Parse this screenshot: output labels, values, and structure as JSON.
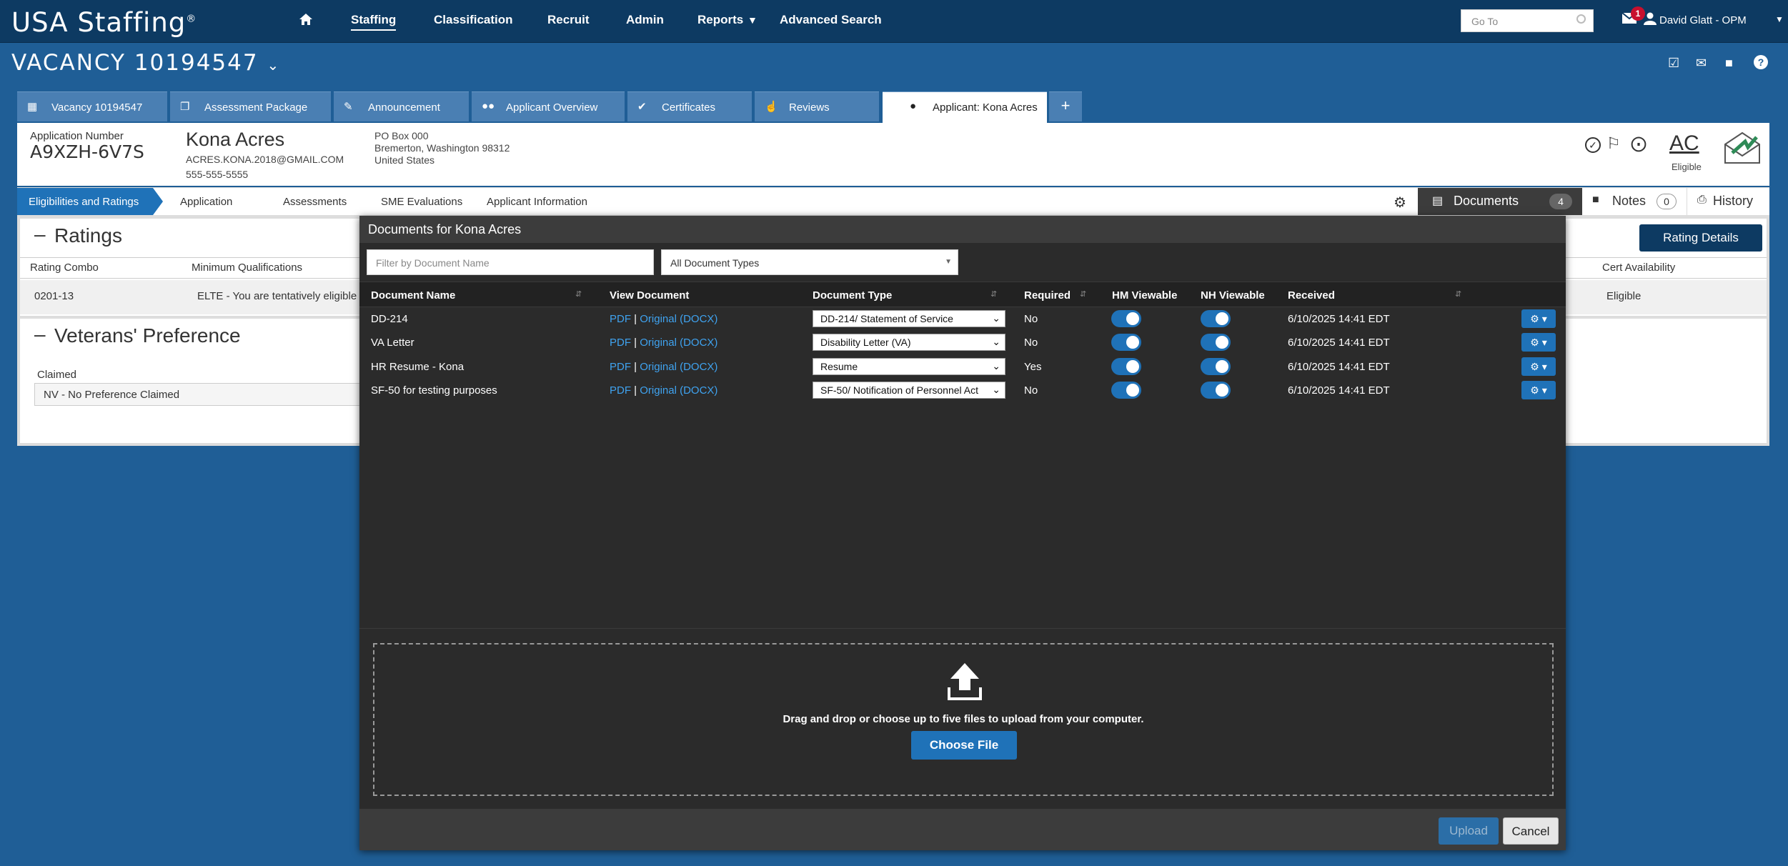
{
  "topnav": {
    "logo": "USA Staffing",
    "logo_mark": "®",
    "items": [
      "Staffing",
      "Classification",
      "Recruit",
      "Admin",
      "Reports",
      "Advanced Search"
    ],
    "goto_placeholder": "Go To",
    "notification_count": "1",
    "user": "David Glatt - OPM"
  },
  "vacancy": {
    "title": "VACANCY 10194547"
  },
  "tabs": [
    {
      "label": "Vacancy 10194547",
      "icon": "calendar-icon"
    },
    {
      "label": "Assessment Package",
      "icon": "copy-icon"
    },
    {
      "label": "Announcement",
      "icon": "megaphone-icon"
    },
    {
      "label": "Applicant Overview",
      "icon": "people-icon"
    },
    {
      "label": "Certificates",
      "icon": "check-circle-icon"
    },
    {
      "label": "Reviews",
      "icon": "thumbs-up-icon"
    },
    {
      "label": "Applicant: Kona Acres",
      "icon": "person-icon"
    }
  ],
  "applicant": {
    "app_num_label": "Application Number",
    "app_num": "A9XZH-6V7S",
    "name": "Kona Acres",
    "email": "ACRES.KONA.2018@GMAIL.COM",
    "phone": "555-555-5555",
    "addr1": "PO Box 000",
    "addr2": "Bremerton, Washington 98312",
    "addr3": "United States",
    "status_code": "AC",
    "status_label": "Eligible"
  },
  "subnav": {
    "items": [
      "Eligibilities and Ratings",
      "Application",
      "Assessments",
      "SME Evaluations",
      "Applicant Information"
    ],
    "documents_label": "Documents",
    "documents_count": "4",
    "notes_label": "Notes",
    "notes_count": "0",
    "history_label": "History"
  },
  "ratings": {
    "title": "Ratings",
    "rating_details": "Rating Details",
    "col1": "Rating Combo",
    "col2": "Minimum Qualifications",
    "col_last": "Cert Availability",
    "row_combo": "0201-13",
    "row_mq": "ELTE - You are tentatively eligible",
    "row_cert": "Eligible"
  },
  "veterans": {
    "title": "Veterans' Preference",
    "claimed_label": "Claimed",
    "claimed_value": "NV - No Preference Claimed"
  },
  "modal": {
    "title": "Documents for Kona Acres",
    "filter_placeholder": "Filter by Document Name",
    "type_filter": "All Document Types",
    "headers": [
      "Document Name",
      "View Document",
      "Document Type",
      "Required",
      "HM Viewable",
      "NH Viewable",
      "Received"
    ],
    "rows": [
      {
        "name": "DD-214",
        "pdf": "PDF",
        "orig": "Original (DOCX)",
        "type": "DD-214/ Statement of Service",
        "required": "No",
        "hm": true,
        "nh": true,
        "received": "6/10/2025 14:41 EDT"
      },
      {
        "name": "VA Letter",
        "pdf": "PDF",
        "orig": "Original (DOCX)",
        "type": "Disability Letter (VA)",
        "required": "No",
        "hm": true,
        "nh": true,
        "received": "6/10/2025 14:41 EDT"
      },
      {
        "name": "HR Resume - Kona",
        "pdf": "PDF",
        "orig": "Original (DOCX)",
        "type": "Resume",
        "required": "Yes",
        "hm": true,
        "nh": true,
        "received": "6/10/2025 14:41 EDT"
      },
      {
        "name": "SF-50 for testing purposes",
        "pdf": "PDF",
        "orig": "Original (DOCX)",
        "type": "SF-50/ Notification of Personnel Act",
        "required": "No",
        "hm": true,
        "nh": true,
        "received": "6/10/2025 14:41 EDT"
      }
    ],
    "drop_text": "Drag and drop or choose up to five files to upload from your computer.",
    "choose_file": "Choose File",
    "upload": "Upload",
    "cancel": "Cancel"
  },
  "colors": {
    "nav": "#0d3a62",
    "accent": "#1f72b8",
    "modal": "#2b2b2b",
    "link": "#3fa3f0"
  }
}
